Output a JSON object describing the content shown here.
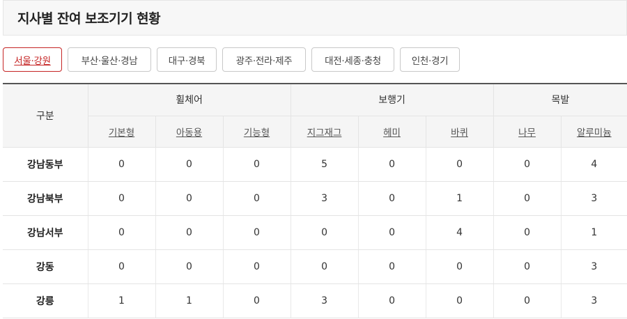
{
  "page": {
    "title": "지사별 잔여 보조기기 현황"
  },
  "tabs": [
    {
      "label": "서울·강원",
      "active": true
    },
    {
      "label": "부산·울산·경남",
      "active": false
    },
    {
      "label": "대구·경북",
      "active": false
    },
    {
      "label": "광주·전라·제주",
      "active": false
    },
    {
      "label": "대전·세종·충청",
      "active": false
    },
    {
      "label": "인천·경기",
      "active": false
    }
  ],
  "table": {
    "corner_label": "구분",
    "groups": [
      {
        "label": "휠체어",
        "columns": [
          "기본형",
          "아동용",
          "기능형"
        ]
      },
      {
        "label": "보행기",
        "columns": [
          "지그재그",
          "헤미",
          "바퀴"
        ]
      },
      {
        "label": "목발",
        "columns": [
          "나무",
          "알루미늄"
        ]
      }
    ],
    "rows": [
      {
        "name": "강남동부",
        "values": [
          "0",
          "0",
          "0",
          "5",
          "0",
          "0",
          "0",
          "4"
        ]
      },
      {
        "name": "강남북부",
        "values": [
          "0",
          "0",
          "0",
          "3",
          "0",
          "1",
          "0",
          "3"
        ]
      },
      {
        "name": "강남서부",
        "values": [
          "0",
          "0",
          "0",
          "0",
          "0",
          "4",
          "0",
          "1"
        ]
      },
      {
        "name": "강동",
        "values": [
          "0",
          "0",
          "0",
          "0",
          "0",
          "0",
          "0",
          "3"
        ]
      },
      {
        "name": "강릉",
        "values": [
          "1",
          "1",
          "0",
          "3",
          "0",
          "0",
          "0",
          "3"
        ]
      }
    ]
  }
}
